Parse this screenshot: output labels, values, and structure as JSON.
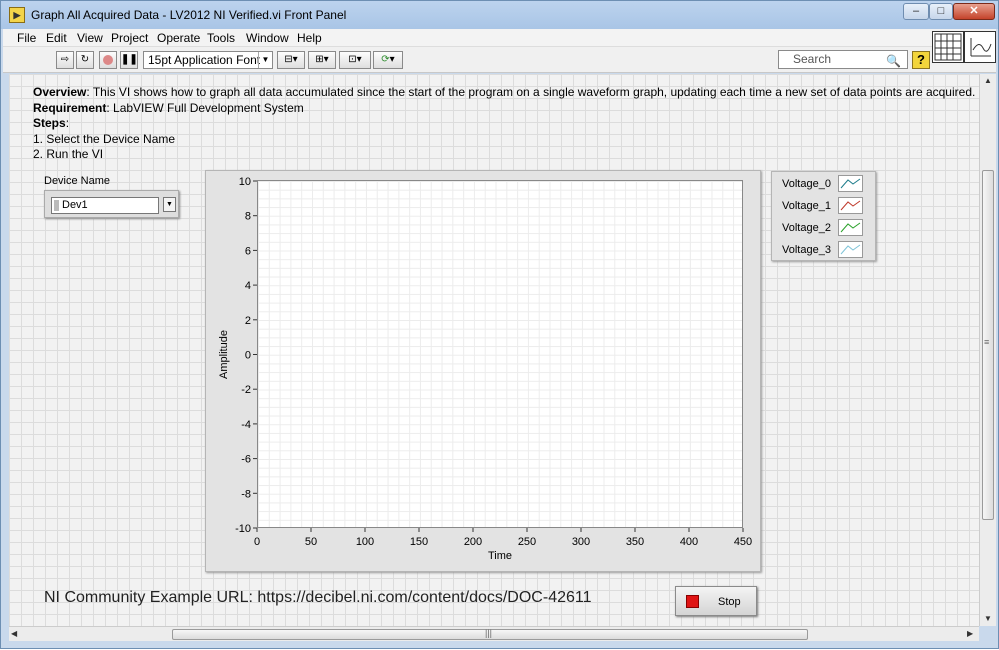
{
  "window": {
    "title": "Graph All Acquired Data - LV2012 NI Verified.vi Front Panel",
    "controls": {
      "minimize": "‒",
      "maximize": "□",
      "close": "✕"
    }
  },
  "menu": [
    "File",
    "Edit",
    "View",
    "Project",
    "Operate",
    "Tools",
    "Window",
    "Help"
  ],
  "toolbar": {
    "font_select": "15pt Application Font",
    "search_placeholder": "Search",
    "help_label": "?"
  },
  "description": {
    "overview_label": "Overview",
    "overview_text": ": This VI shows how to graph all data accumulated since the start of the program on a single waveform graph, updating each time a new set of data points are acquired.",
    "requirement_label": "Requirement",
    "requirement_text": ": LabVIEW Full Development System",
    "steps_label": "Steps",
    "steps_colon": ":",
    "steps": [
      "1. Select the Device Name",
      "2. Run the VI"
    ]
  },
  "device": {
    "label": "Device Name",
    "value": "Dev1"
  },
  "chart_data": {
    "type": "line",
    "xlabel": "Time",
    "ylabel": "Amplitude",
    "xlim": [
      0,
      450
    ],
    "ylim": [
      -10,
      10
    ],
    "x_ticks": [
      "0",
      "50",
      "100",
      "150",
      "200",
      "250",
      "300",
      "350",
      "400",
      "450"
    ],
    "y_ticks": [
      "10",
      "8",
      "6",
      "4",
      "2",
      "0",
      "-2",
      "-4",
      "-6",
      "-8",
      "-10"
    ],
    "grid": true,
    "legend_position": "right",
    "series": [
      {
        "name": "Voltage_0",
        "color": "#1f7d8c",
        "values": []
      },
      {
        "name": "Voltage_1",
        "color": "#c0392b",
        "values": []
      },
      {
        "name": "Voltage_2",
        "color": "#2aa12a",
        "values": []
      },
      {
        "name": "Voltage_3",
        "color": "#7fc4d8",
        "values": []
      }
    ]
  },
  "footer": {
    "url_text": "NI Community Example URL: https://decibel.ni.com/content/docs/DOC-42611",
    "stop_label": "Stop"
  },
  "scrollbars": {
    "h_grip": "|||",
    "v_grip": "≡"
  }
}
